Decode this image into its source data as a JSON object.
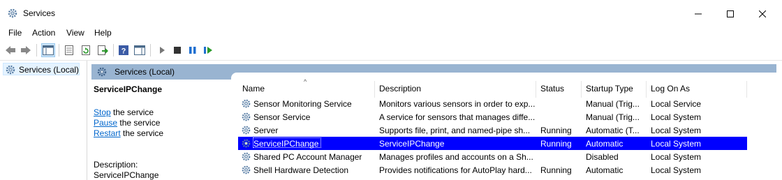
{
  "window": {
    "title": "Services"
  },
  "menu": [
    "File",
    "Action",
    "View",
    "Help"
  ],
  "toolbar": {
    "icons": [
      "back-arrow-icon",
      "forward-arrow-icon",
      "show-hide-console-tree-icon",
      "properties-icon",
      "refresh-icon",
      "export-list-icon",
      "help-icon",
      "action-pane-icon",
      "start-service-icon",
      "stop-service-icon",
      "pause-service-icon",
      "restart-service-icon"
    ]
  },
  "tree": {
    "root_label": "Services (Local)"
  },
  "pane": {
    "header": "Services (Local)"
  },
  "detail": {
    "service_name": "ServiceIPChange",
    "actions": [
      {
        "link": "Stop",
        "rest": " the service"
      },
      {
        "link": "Pause",
        "rest": " the service"
      },
      {
        "link": "Restart",
        "rest": " the service"
      }
    ],
    "description_label": "Description:",
    "description_text": "ServiceIPChange"
  },
  "table": {
    "columns": [
      "Name",
      "Description",
      "Status",
      "Startup Type",
      "Log On As"
    ],
    "sorted_column": "Name",
    "rows": [
      {
        "name": "Sensor Monitoring Service",
        "description": "Monitors various sensors in order to exp...",
        "status": "",
        "startup": "Manual (Trig...",
        "logon": "Local Service"
      },
      {
        "name": "Sensor Service",
        "description": "A service for sensors that manages diffe...",
        "status": "",
        "startup": "Manual (Trig...",
        "logon": "Local System"
      },
      {
        "name": "Server",
        "description": "Supports file, print, and named-pipe sh...",
        "status": "Running",
        "startup": "Automatic (T...",
        "logon": "Local System"
      },
      {
        "name": "ServiceIPChange",
        "description": "ServiceIPChange",
        "status": "Running",
        "startup": "Automatic",
        "logon": "Local System",
        "selected": true
      },
      {
        "name": "Shared PC Account Manager",
        "description": "Manages profiles and accounts on a Sh...",
        "status": "",
        "startup": "Disabled",
        "logon": "Local System"
      },
      {
        "name": "Shell Hardware Detection",
        "description": "Provides notifications for AutoPlay hard...",
        "status": "Running",
        "startup": "Automatic",
        "logon": "Local System"
      }
    ]
  },
  "colors": {
    "selection": "#0000ff",
    "header_band": "#99b4d1",
    "link": "#0066cc"
  }
}
